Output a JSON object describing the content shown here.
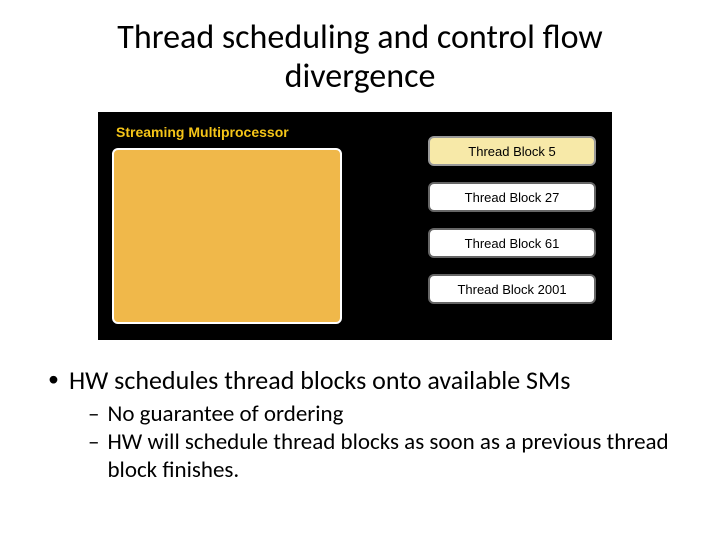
{
  "title": "Thread scheduling and control flow divergence",
  "diagram": {
    "sm_label": "Streaming Multiprocessor",
    "blocks": [
      {
        "label": "Thread Block 5",
        "highlight": true
      },
      {
        "label": "Thread Block 27",
        "highlight": false
      },
      {
        "label": "Thread Block 61",
        "highlight": false
      },
      {
        "label": "Thread Block 2001",
        "highlight": false
      }
    ]
  },
  "bullets": {
    "main": "HW schedules thread blocks onto available SMs",
    "sub1": "No guarantee of ordering",
    "sub2": "HW will schedule thread blocks as soon as a previous thread block finishes."
  }
}
